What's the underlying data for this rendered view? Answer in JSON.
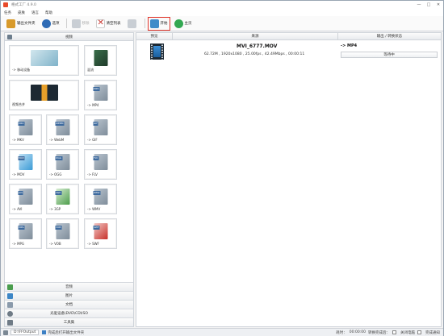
{
  "window": {
    "title": "格式工厂 4.9.0",
    "controls": [
      "—",
      "□",
      "✕"
    ]
  },
  "menu": [
    "任务",
    "皮肤",
    "语言",
    "帮助"
  ],
  "toolbar": {
    "buttons": [
      {
        "label": "输出文件夹",
        "icon": "output-folder-icon",
        "color": "#d89a2b",
        "disabled": false
      },
      {
        "label": "选项",
        "icon": "options-icon",
        "color": "#2e6bb5",
        "disabled": false
      },
      {
        "label": "移除",
        "icon": "remove-icon",
        "color": "#c9ced4",
        "disabled": true
      },
      {
        "label": "清空列表",
        "icon": "clear-list-icon",
        "color": "#c8322b",
        "disabled": false
      },
      {
        "label": "",
        "icon": "stop-icon",
        "color": "#c9ced4",
        "disabled": true
      },
      {
        "label": "开始",
        "icon": "start-icon",
        "color": "#3f8bc9",
        "disabled": false
      },
      {
        "label": "主页",
        "icon": "home-icon",
        "color": "#33a852",
        "disabled": false
      }
    ]
  },
  "left_panel": {
    "header": "视频",
    "tiles": [
      {
        "label": "-> 移动设备",
        "tag": ""
      },
      {
        "label": "混流",
        "tag": ""
      },
      {
        "label": "视频合并",
        "tag": ""
      },
      {
        "label": "-> MP4",
        "tag": "MP4"
      },
      {
        "label": "-> MKV",
        "tag": "MKV"
      },
      {
        "label": "-> WebM",
        "tag": "WEBM"
      },
      {
        "label": "-> GIF",
        "tag": "GIF"
      },
      {
        "label": "-> MOV",
        "tag": "MOV"
      },
      {
        "label": "-> OGG",
        "tag": "OGG"
      },
      {
        "label": "-> FLV",
        "tag": "FLV"
      },
      {
        "label": "-> AVI",
        "tag": "AVI"
      },
      {
        "label": "-> 3GP",
        "tag": "3GP"
      },
      {
        "label": "-> WMV",
        "tag": "WMV"
      },
      {
        "label": "-> MPG",
        "tag": "MPG"
      },
      {
        "label": "-> VOB",
        "tag": "VOB"
      },
      {
        "label": "-> SWF",
        "tag": "SWF"
      }
    ],
    "categories": [
      {
        "label": "音频",
        "icon": "audio-icon",
        "color": "#4a9d4d"
      },
      {
        "label": "图片",
        "icon": "picture-icon",
        "color": "#3d86c6"
      },
      {
        "label": "文档",
        "icon": "document-icon",
        "color": "#8a9aab"
      },
      {
        "label": "光驱设备\\DVD\\CD\\ISO",
        "icon": "disc-icon",
        "color": "#6f7b86"
      },
      {
        "label": "工具集",
        "icon": "tools-icon",
        "color": "#6f7b86"
      }
    ]
  },
  "task_list": {
    "columns": {
      "preview": "预览",
      "source": "来源",
      "output": "输出 / 转换状态"
    },
    "tasks": [
      {
        "filename": "MVI_6777.MOV",
        "info": "62.72M , 1920x1080 , 25.00fps , 42.49Mbps , 00:00:11",
        "target": "-> MP4",
        "status": "等待中"
      }
    ]
  },
  "statusbar": {
    "path": "D:\\FFOutput",
    "open_output": "完成后打开输出文件夹",
    "elapsed_label": "耗时：",
    "elapsed": "00:00:00",
    "after_label": "转换完成后：",
    "shutdown": "关闭电脑",
    "notify": "完成通知"
  }
}
